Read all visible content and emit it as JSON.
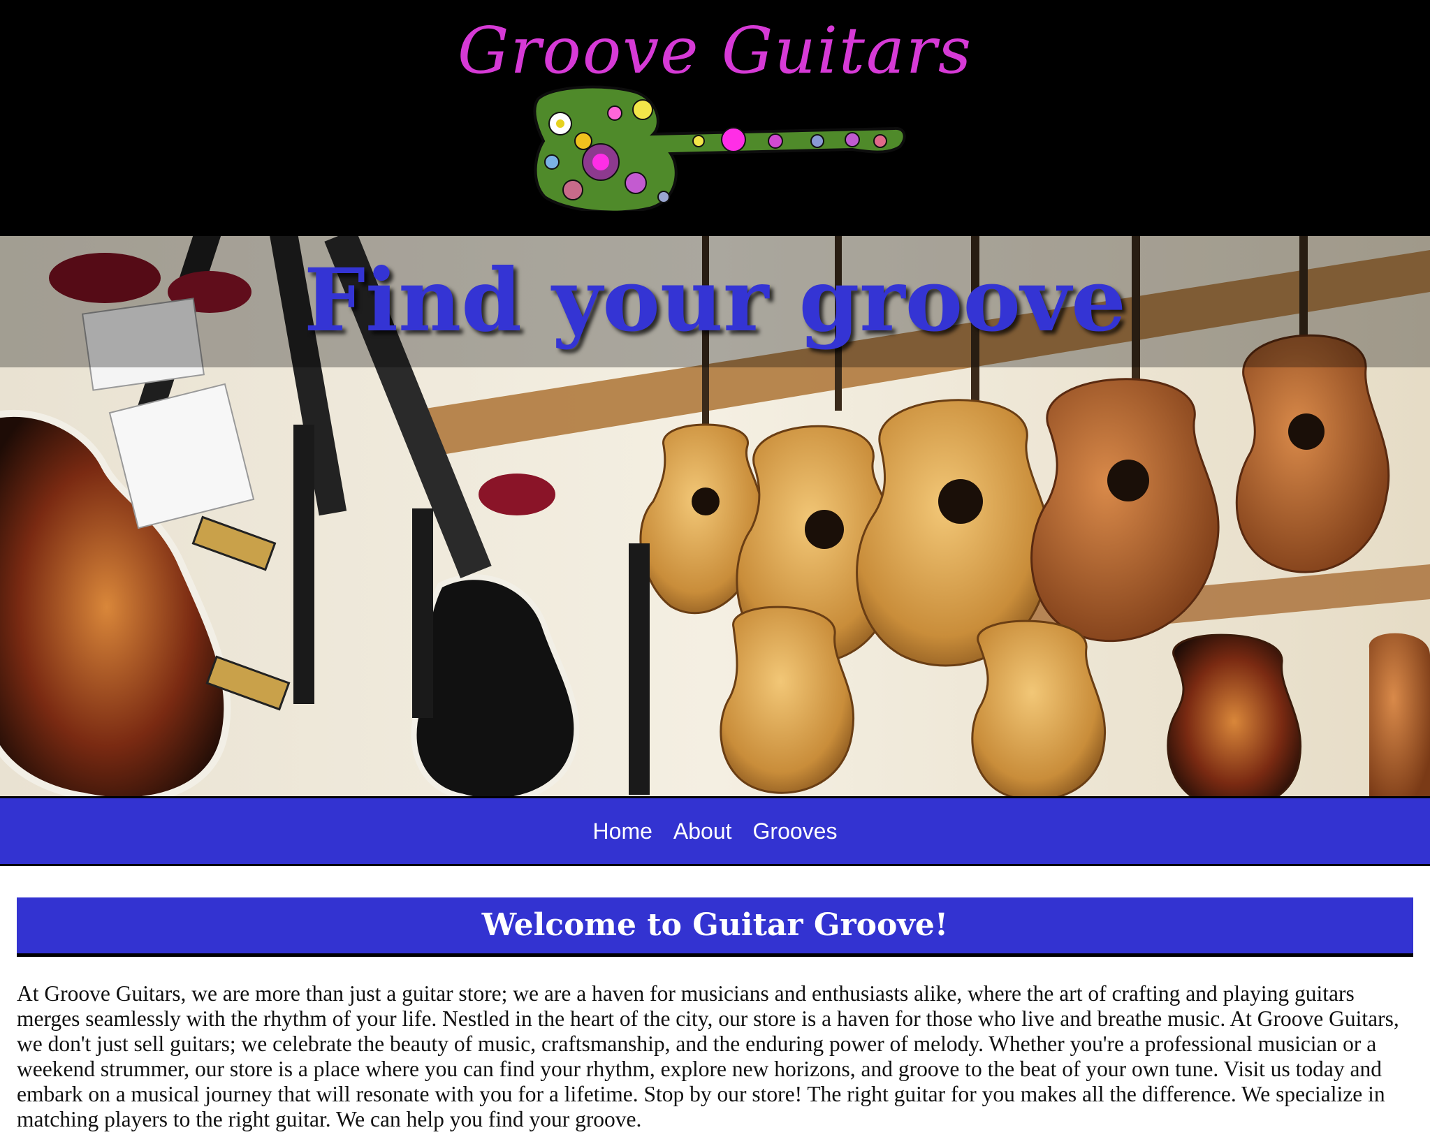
{
  "header": {
    "logo_text": "Groove Guitars",
    "logo_image": "flower-guitar-logo",
    "logo_color": "#d63ad6"
  },
  "hero": {
    "title": "Find your groove",
    "title_color": "#3434d4",
    "image": "guitar-store-photo"
  },
  "nav": {
    "background": "#3333d1",
    "items": [
      {
        "label": "Home"
      },
      {
        "label": "About"
      },
      {
        "label": "Grooves"
      }
    ]
  },
  "main": {
    "heading": "Welcome to Guitar Groove!",
    "paragraph": "At Groove Guitars, we are more than just a guitar store; we are a haven for musicians and enthusiasts alike, where the art of crafting and playing guitars merges seamlessly with the rhythm of your life. Nestled in the heart of the city, our store is a haven for those who live and breathe music. At Groove Guitars, we don't just sell guitars; we celebrate the beauty of music, craftsmanship, and the enduring power of melody. Whether you're a professional musician or a weekend strummer, our store is a place where you can find your rhythm, explore new horizons, and groove to the beat of your own tune. Visit us today and embark on a musical journey that will resonate with you for a lifetime. Stop by our store! The right guitar for you makes all the difference. We specialize in matching players to the right guitar. We can help you find your groove."
  }
}
